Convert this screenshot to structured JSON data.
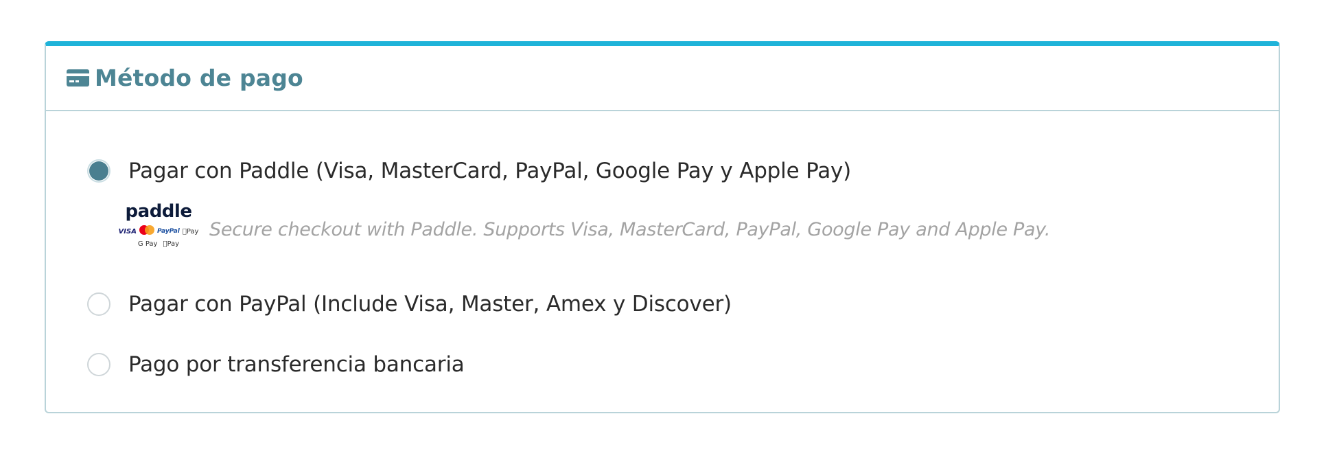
{
  "panel": {
    "title": "Método de pago",
    "icon": "credit-card-icon",
    "accent_color": "#1fb3d9",
    "title_color": "#4d8594"
  },
  "options": [
    {
      "label": "Pagar con Paddle (Visa, MasterCard, PayPal, Google Pay y Apple Pay)",
      "selected": true
    },
    {
      "label": "Pagar con PayPal (Include Visa, Master, Amex y Discover)",
      "selected": false
    },
    {
      "label": "Pago por transferencia bancaria",
      "selected": false
    }
  ],
  "paddle": {
    "logo_text": "paddle",
    "brands": {
      "visa": "VISA",
      "paypal": "PayPal",
      "apple_pay": "Pay",
      "google_pay": "G Pay",
      "apple_pay_2": "Pay"
    },
    "description": "Secure checkout with Paddle. Supports Visa, MasterCard, PayPal, Google Pay and Apple Pay."
  }
}
